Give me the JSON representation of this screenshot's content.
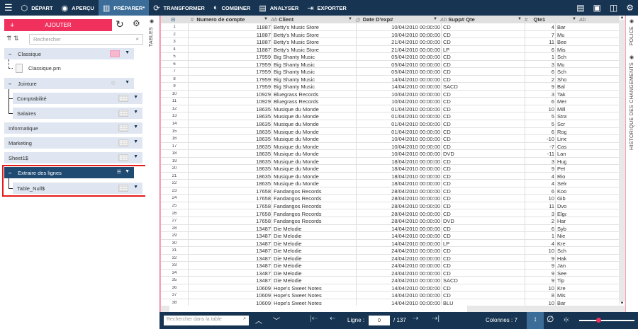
{
  "topbar": {
    "items": [
      {
        "label": "DÉPART",
        "icon": "cube-icon"
      },
      {
        "label": "APERÇU",
        "icon": "eye-icon"
      },
      {
        "label": "PRÉPARER*",
        "icon": "prepare-icon",
        "active": true
      },
      {
        "label": "TRANSFORMER",
        "icon": "transform-icon"
      },
      {
        "label": "COMBINER",
        "icon": "combine-icon"
      },
      {
        "label": "ANALYSER",
        "icon": "clipboard-icon"
      },
      {
        "label": "EXPORTER",
        "icon": "export-icon"
      }
    ]
  },
  "left": {
    "add_label": "AJOUTER",
    "search_placeholder": "Rechercher",
    "tree": {
      "classique": "Classique",
      "classique_file": "Classique.prn",
      "jointure": "Jointure",
      "comptabilite": "Comptabilité",
      "salaires": "Salaires",
      "informatique": "Informatique",
      "marketing": "Marketing",
      "sheet1": "Sheet1$",
      "extraire": "Extraire des lignes",
      "table_null": "Table_Null$"
    }
  },
  "side_tabs": {
    "tables": "TABLES",
    "police": "POLICE",
    "historique": "HISTORIQUE DES CHANGEMENTS"
  },
  "grid": {
    "columns": [
      {
        "type": "#",
        "name": "Numero de compte"
      },
      {
        "type": "Ab",
        "name": "Client"
      },
      {
        "type": "◷",
        "name": "Date D'exp#"
      },
      {
        "type": "Ab",
        "name": "Supp# Qte"
      },
      {
        "type": "#",
        "name": "Qte1"
      },
      {
        "type": "Ab",
        "name": ""
      }
    ],
    "rows": [
      [
        "1",
        "11887",
        "Betty's Music Store",
        "10/04/2010 00:00:00",
        "CD",
        "4",
        "Bar"
      ],
      [
        "2",
        "11887",
        "Betty's Music Store",
        "10/04/2010 00:00:00",
        "CD",
        "7",
        "Mu"
      ],
      [
        "3",
        "11887",
        "Betty's Music Store",
        "21/04/2010 00:00:00",
        "CD",
        "11",
        "Bee"
      ],
      [
        "4",
        "11887",
        "Betty's Music Store",
        "21/04/2010 00:00:00",
        "LP",
        "6",
        "Mis"
      ],
      [
        "5",
        "17959",
        "Big Shanty Music",
        "05/04/2010 00:00:00",
        "CD",
        "1",
        "Sch"
      ],
      [
        "6",
        "17959",
        "Big Shanty Music",
        "05/04/2010 00:00:00",
        "CD",
        "3",
        "Mu"
      ],
      [
        "7",
        "17959",
        "Big Shanty Music",
        "05/04/2010 00:00:00",
        "CD",
        "6",
        "Sch"
      ],
      [
        "8",
        "17959",
        "Big Shanty Music",
        "14/04/2010 00:00:00",
        "CD",
        "2",
        "Sho"
      ],
      [
        "9",
        "17959",
        "Big Shanty Music",
        "14/04/2010 00:00:00",
        "SACD",
        "9",
        "Bal"
      ],
      [
        "10",
        "10929",
        "Bluegrass Records",
        "10/04/2010 00:00:00",
        "CD",
        "3",
        "Tak"
      ],
      [
        "11",
        "10929",
        "Bluegrass Records",
        "10/04/2010 00:00:00",
        "CD",
        "6",
        "Mes"
      ],
      [
        "12",
        "18635",
        "Musique du Monde",
        "01/04/2010 00:00:00",
        "CD",
        "10",
        "Mill"
      ],
      [
        "13",
        "18635",
        "Musique du Monde",
        "01/04/2010 00:00:00",
        "CD",
        "5",
        "Stra"
      ],
      [
        "14",
        "18635",
        "Musique du Monde",
        "01/04/2010 00:00:00",
        "CD",
        "5",
        "Scr"
      ],
      [
        "15",
        "18635",
        "Musique du Monde",
        "01/04/2010 00:00:00",
        "CD",
        "6",
        "Rog"
      ],
      [
        "16",
        "18635",
        "Musique du Monde",
        "10/04/2010 00:00:00",
        "CD",
        "-10",
        "Line"
      ],
      [
        "17",
        "18635",
        "Musique du Monde",
        "10/04/2010 00:00:00",
        "CD",
        "-7",
        "Cas"
      ],
      [
        "18",
        "18635",
        "Musique du Monde",
        "10/04/2010 00:00:00",
        "DVD",
        "-11",
        "Lan"
      ],
      [
        "19",
        "18635",
        "Musique du Monde",
        "18/04/2010 00:00:00",
        "CD",
        "3",
        "Hug"
      ],
      [
        "20",
        "18635",
        "Musique du Monde",
        "18/04/2010 00:00:00",
        "CD",
        "9",
        "Pet"
      ],
      [
        "21",
        "18635",
        "Musique du Monde",
        "18/04/2010 00:00:00",
        "CD",
        "4",
        "Rio"
      ],
      [
        "22",
        "18635",
        "Musique du Monde",
        "18/04/2010 00:00:00",
        "CD",
        "4",
        "Sele"
      ],
      [
        "23",
        "17658",
        "Fandangos Records",
        "28/04/2010 00:00:00",
        "CD",
        "6",
        "Koo"
      ],
      [
        "24",
        "17658",
        "Fandangos Records",
        "28/04/2010 00:00:00",
        "CD",
        "10",
        "Gib"
      ],
      [
        "25",
        "17658",
        "Fandangos Records",
        "28/04/2010 00:00:00",
        "CD",
        "11",
        "Dvo"
      ],
      [
        "26",
        "17658",
        "Fandangos Records",
        "28/04/2010 00:00:00",
        "CD",
        "3",
        "Elga"
      ],
      [
        "27",
        "17658",
        "Fandangos Records",
        "28/04/2010 00:00:00",
        "DVD",
        "2",
        "Har"
      ],
      [
        "28",
        "13487",
        "Die Melodie",
        "14/04/2010 00:00:00",
        "CD",
        "6",
        "Syb"
      ],
      [
        "29",
        "13487",
        "Die Melodie",
        "14/04/2010 00:00:00",
        "CD",
        "1",
        "Nie"
      ],
      [
        "30",
        "13487",
        "Die Melodie",
        "14/04/2010 00:00:00",
        "LP",
        "4",
        "Kre"
      ],
      [
        "31",
        "13487",
        "Die Melodie",
        "24/04/2010 00:00:00",
        "CD",
        "10",
        "Sch"
      ],
      [
        "32",
        "13487",
        "Die Melodie",
        "24/04/2010 00:00:00",
        "CD",
        "9",
        "Hak"
      ],
      [
        "33",
        "13487",
        "Die Melodie",
        "24/04/2010 00:00:00",
        "CD",
        "9",
        "Jan"
      ],
      [
        "34",
        "13487",
        "Die Melodie",
        "24/04/2010 00:00:00",
        "CD",
        "9",
        "See"
      ],
      [
        "35",
        "13487",
        "Die Melodie",
        "24/04/2010 00:00:00",
        "SACD",
        "9",
        "Tip"
      ],
      [
        "36",
        "10609",
        "Hope's Sweet Notes",
        "14/04/2010 00:00:00",
        "CD",
        "10",
        "Kre"
      ],
      [
        "37",
        "10609",
        "Hope's Sweet Notes",
        "14/04/2010 00:00:00",
        "CD",
        "8",
        "Mis"
      ],
      [
        "38",
        "10609",
        "Hope's Sweet Notes",
        "14/04/2010 00:00:00",
        "BLU",
        "10",
        "Bar"
      ]
    ]
  },
  "footer": {
    "search_placeholder": "Rechercher dans la table",
    "line_label": "Ligne :",
    "line_value": "0",
    "line_total": "/ 137",
    "columns_label": "Colonnes : 7",
    "zoom_fraction": 0.35
  },
  "colors": {
    "topbar": "#173552",
    "accent": "#f0315e",
    "active": "#3c6c98"
  }
}
